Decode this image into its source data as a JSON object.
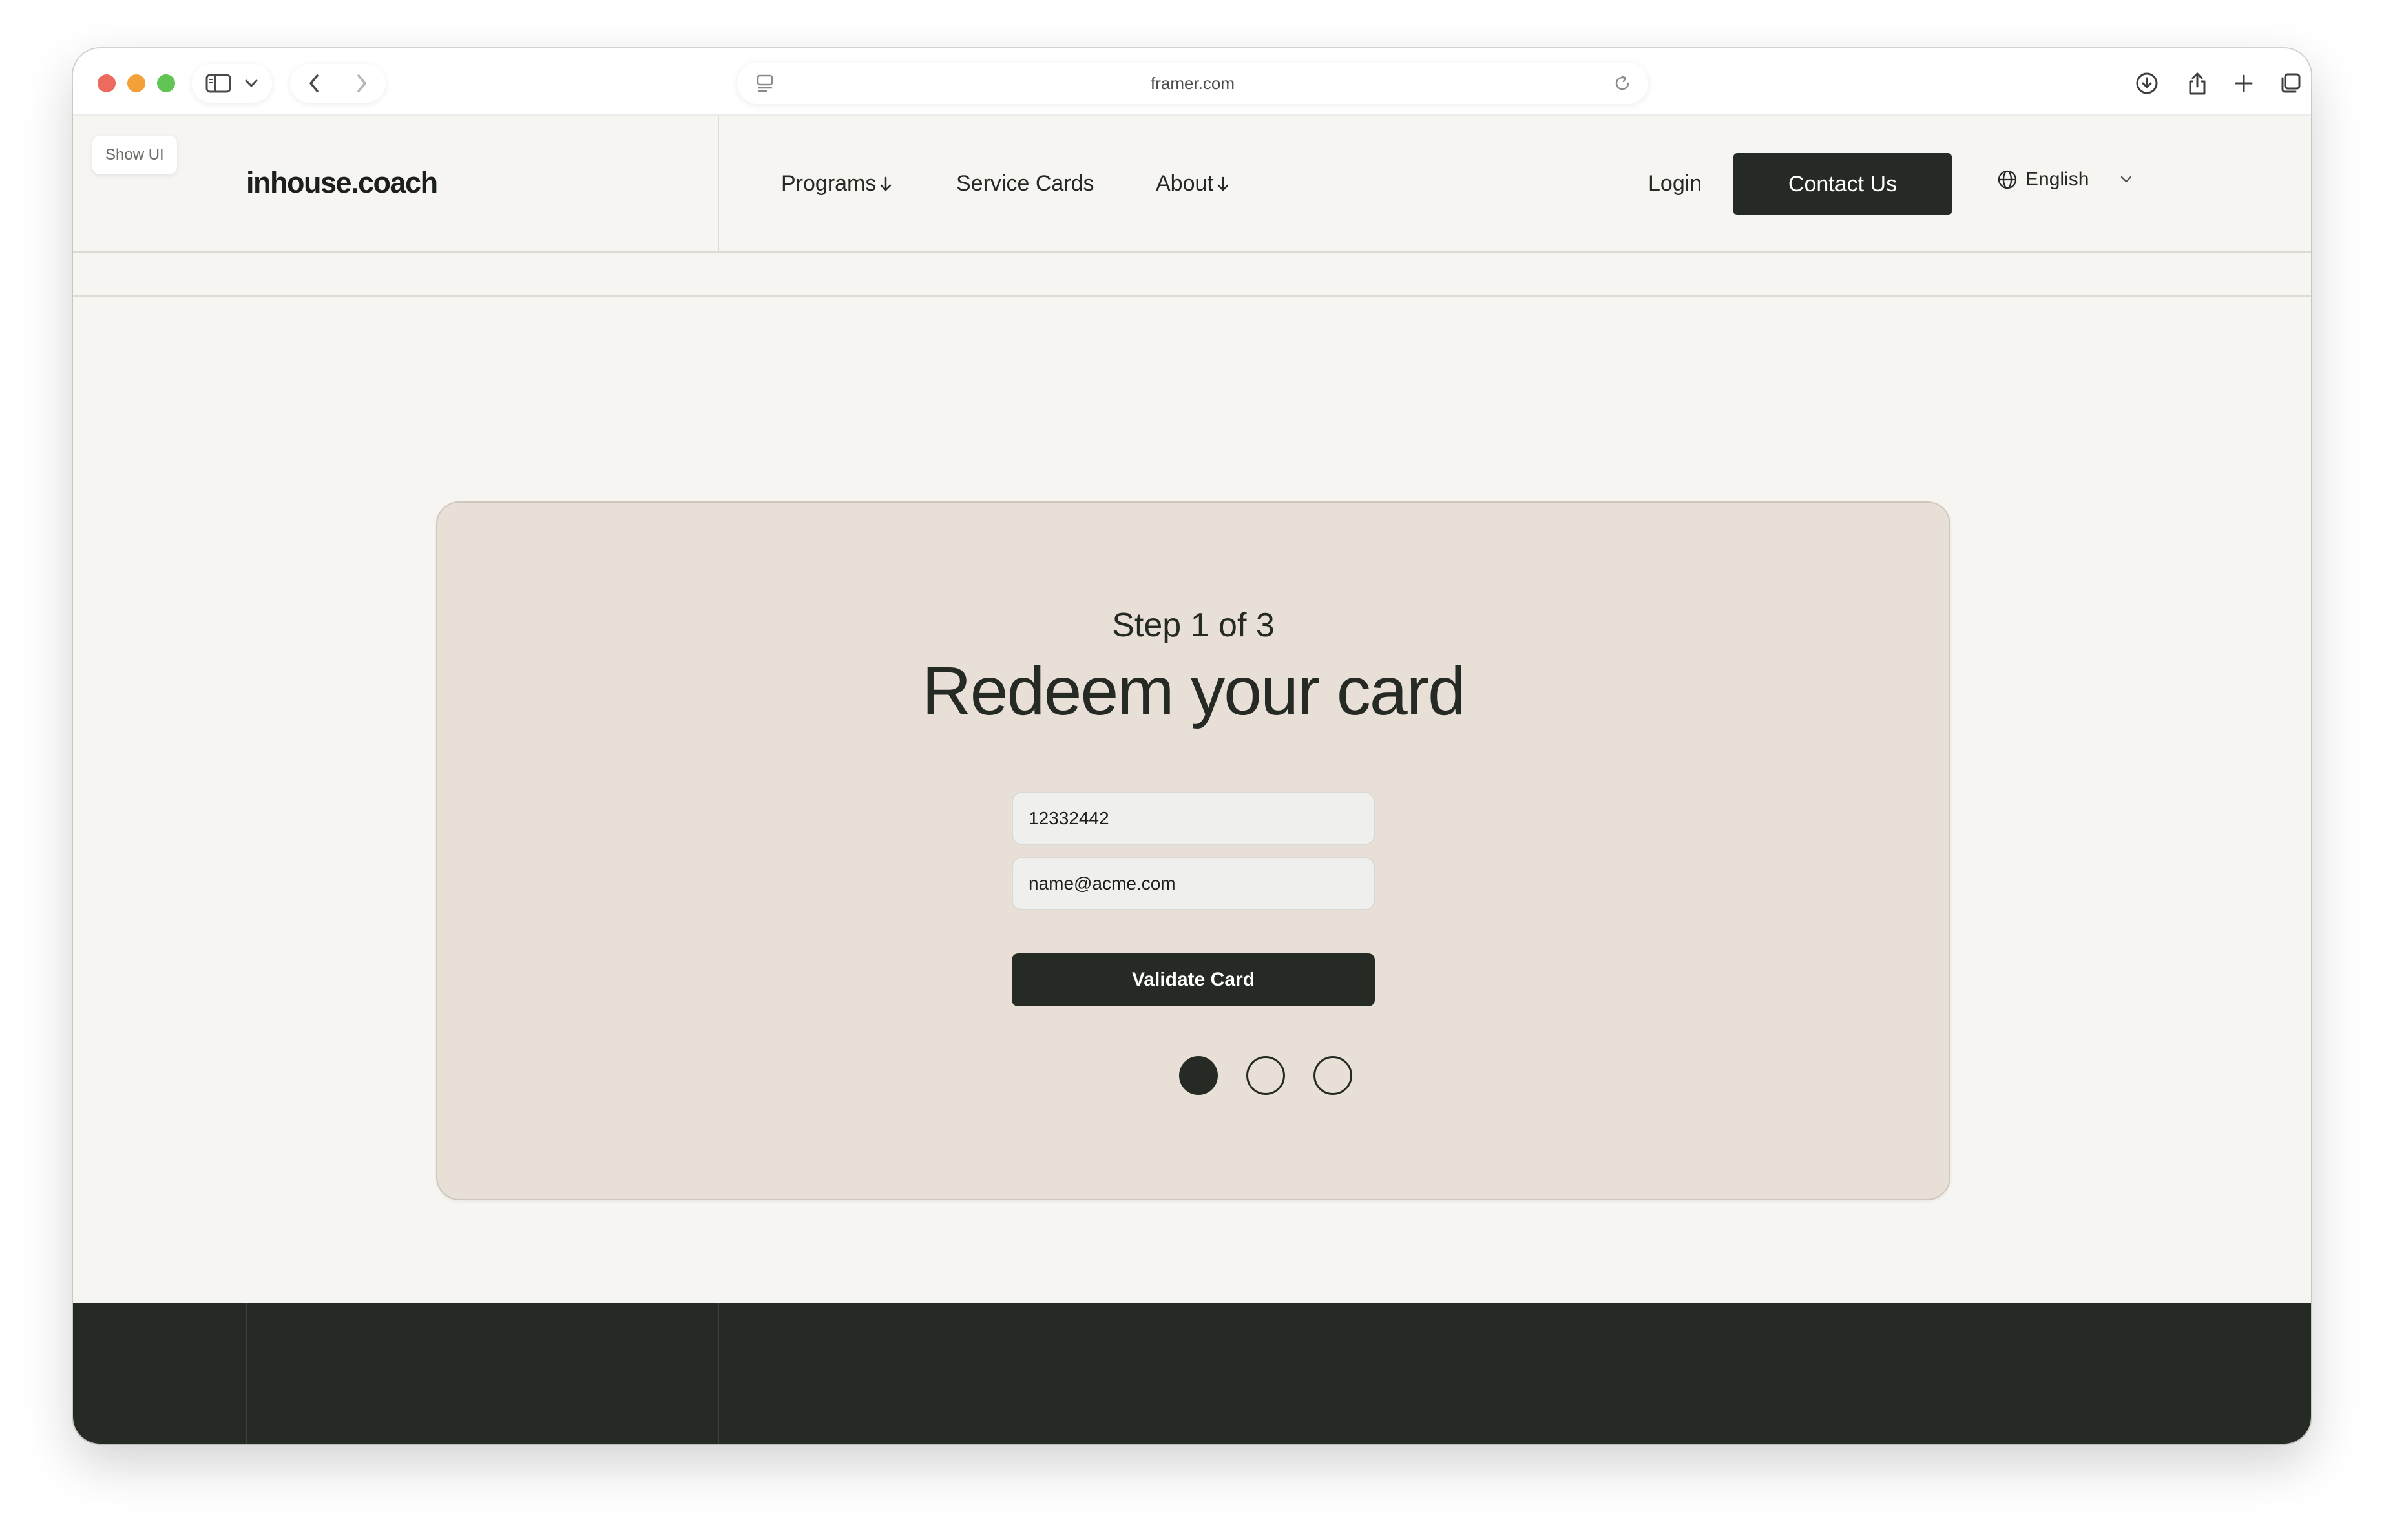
{
  "browser": {
    "url": "framer.com",
    "icons": {
      "sidebar": "sidebar-icon",
      "dropdown": "chevron-down-icon",
      "back": "chevron-left-icon",
      "forward": "chevron-right-icon",
      "site": "page-icon",
      "reload": "reload-icon",
      "downloads": "download-icon",
      "share": "share-icon",
      "new_tab": "plus-icon",
      "tabs": "tabs-icon"
    }
  },
  "site": {
    "show_ui_label": "Show UI",
    "logo": "inhouse.coach",
    "nav": {
      "programs": "Programs",
      "service_cards": "Service Cards",
      "about": "About",
      "login": "Login",
      "contact": "Contact Us",
      "language": "English"
    },
    "card": {
      "step": "Step 1 of 3",
      "title": "Redeem your card",
      "card_number_value": "12332442",
      "email_value": "name@acme.com",
      "validate_label": "Validate Card",
      "current_step": 1,
      "total_steps": 3
    }
  },
  "colors": {
    "page_bg": "#f6f5f1",
    "card_bg": "#e8e0d6",
    "dark": "#262a24",
    "accent_text": "#ffffff"
  }
}
